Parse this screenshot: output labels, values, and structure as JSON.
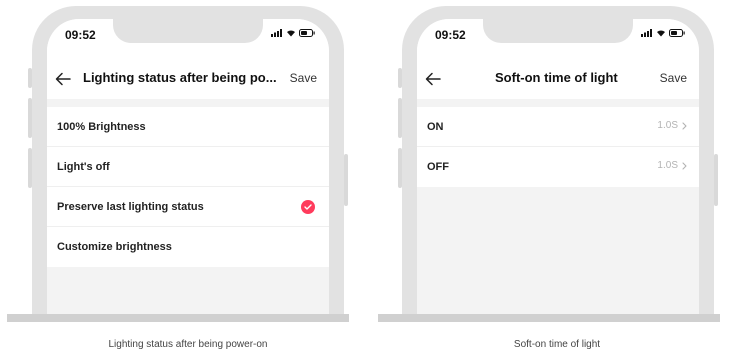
{
  "left_phone": {
    "status_time": "09:52",
    "title": "Lighting status after being po...",
    "save_label": "Save",
    "options": [
      {
        "label": "100% Brightness",
        "selected": false
      },
      {
        "label": "Light's off",
        "selected": false
      },
      {
        "label": "Preserve last lighting status",
        "selected": true
      },
      {
        "label": "Customize brightness",
        "selected": false
      }
    ],
    "caption": "Lighting status after being power-on"
  },
  "right_phone": {
    "status_time": "09:52",
    "title": "Soft-on time of light",
    "save_label": "Save",
    "rows": [
      {
        "label": "ON",
        "value": "1.0S"
      },
      {
        "label": "OFF",
        "value": "1.0S"
      }
    ],
    "caption": "Soft-on time of light"
  },
  "colors": {
    "accent": "#ff3b5c",
    "frame": "#e2e2e2",
    "screen_bg": "#f3f3f3",
    "muted_text": "#b3b3b3"
  },
  "icons": [
    "back-arrow-icon",
    "cellular-signal-icon",
    "wifi-icon",
    "battery-icon",
    "checkmark-icon",
    "chevron-right-icon"
  ]
}
